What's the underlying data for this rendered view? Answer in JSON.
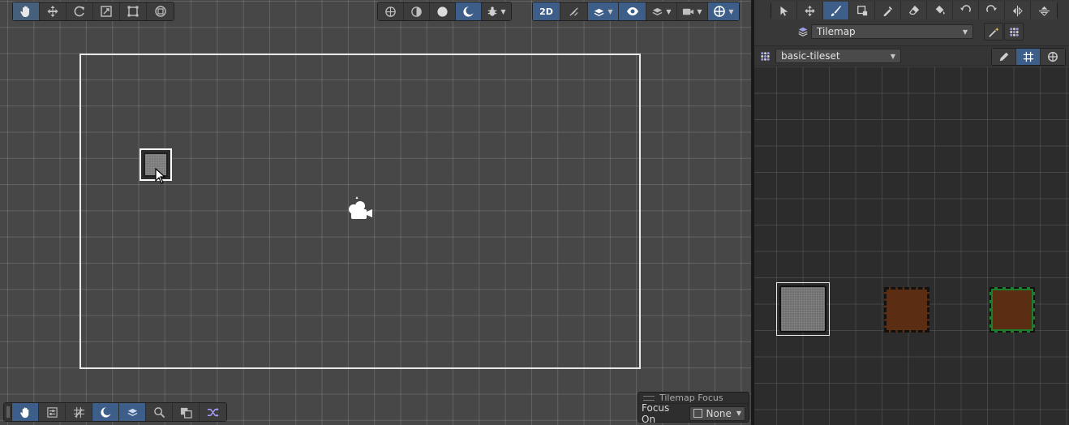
{
  "scene_toolbar": {
    "tools": [
      "hand-tool",
      "move-tool",
      "rotate-tool",
      "scale-tool",
      "rect-tool",
      "transform-tool"
    ],
    "draw_modes": [
      "global-icon",
      "pivot-icon",
      "shaded-sphere-icon",
      "lighting-icon",
      "debug-bug-icon"
    ],
    "toggle_2d_label": "2D"
  },
  "bottom_overlay_toolbar": [
    "hand-icon",
    "sliders-icon",
    "grid-icon",
    "orientation-icon",
    "layers-icon",
    "search-icon",
    "tiles-icon",
    "shuffle-icon"
  ],
  "tilemap_focus": {
    "title": "Tilemap Focus",
    "label": "Focus On",
    "value": "None"
  },
  "palette": {
    "tools": [
      "select-tool",
      "move-tool",
      "paint-brush-tool",
      "box-fill-tool",
      "picker-tool",
      "eraser-tool",
      "flood-fill-tool",
      "rotate-ccw-tool",
      "rotate-cw-tool",
      "flip-x-tool",
      "flip-y-tool"
    ],
    "active_tilemap": "Tilemap",
    "palette_name": "basic-tileset",
    "tiles": [
      "stone",
      "dirt",
      "grass"
    ]
  },
  "colors": {
    "accent": "#3d5e88",
    "scene_bg": "#474747",
    "palette_bg": "#2c2c2c",
    "selection": "#ffffff"
  }
}
